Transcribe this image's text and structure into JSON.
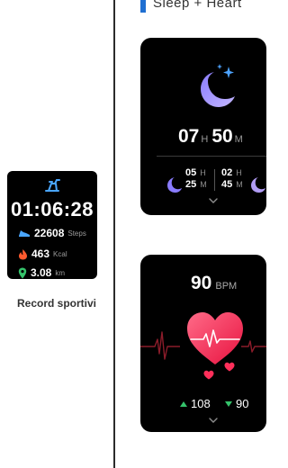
{
  "header": {
    "partial_text": "Sleep + Heart"
  },
  "workout_record": {
    "time": "01:06:28",
    "steps_value": "22608",
    "steps_unit": "Steps",
    "kcal_value": "463",
    "kcal_unit": "Kcal",
    "km_value": "3.08",
    "km_unit": "km",
    "caption": "Record sportivi"
  },
  "sleep": {
    "total_hours": "07",
    "hours_unit": "H",
    "total_minutes": "50",
    "minutes_unit": "M",
    "deep_hours": "05",
    "deep_minutes": "25",
    "light_hours": "02",
    "light_minutes": "45",
    "small_h": "H",
    "small_m": "M"
  },
  "heart_rate": {
    "bpm_value": "90",
    "bpm_unit": "BPM",
    "high": "108",
    "low": "90"
  },
  "colors": {
    "accent_blue": "#1f6fd1",
    "moon_purple": "#7f6bf2",
    "heart_red": "#ff2f5a",
    "green": "#35c36b"
  }
}
